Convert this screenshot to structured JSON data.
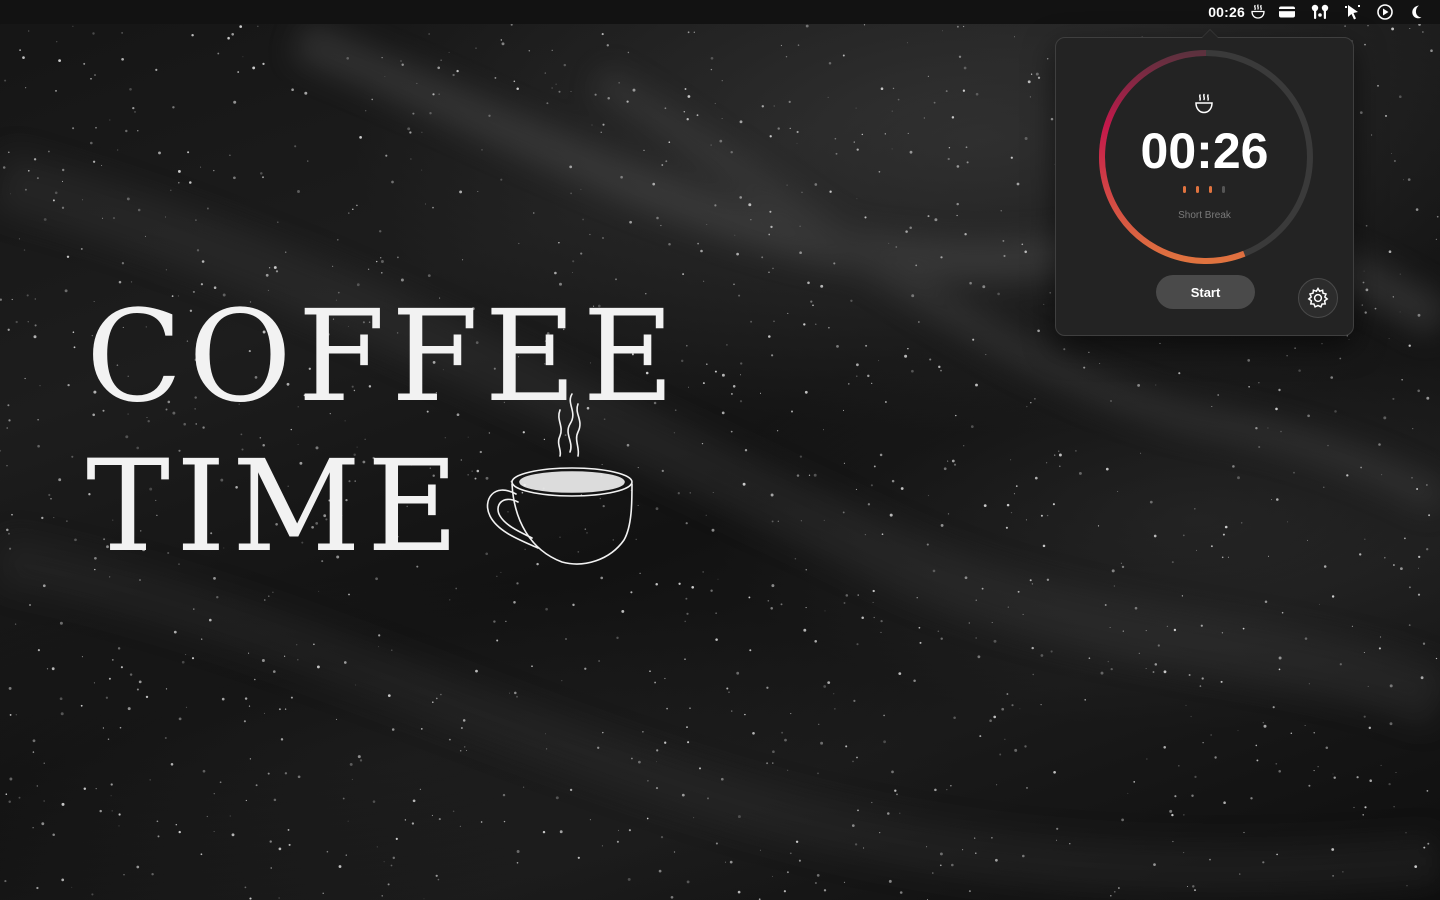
{
  "menubar": {
    "timer_text": "00:26",
    "icons": [
      "coffee-cup-icon",
      "card-icon",
      "airpods-icon",
      "cursor-icon",
      "play-circle-icon",
      "moon-icon"
    ]
  },
  "wallpaper": {
    "title_line1": "COFFEE",
    "title_line2": "TIME",
    "cup_drawing": "coffee-cup-illustration"
  },
  "timer_popover": {
    "time": "00:26",
    "mode": "Short Break",
    "start_label": "Start",
    "sessions_completed": 3,
    "sessions_total": 4,
    "progress_fraction": 0.56,
    "colors": {
      "progress_start": "#e0733f",
      "progress_end": "#c4184b",
      "track": "#3a3a3a",
      "dot_active": "#e0733f",
      "dot_inactive": "#555555"
    },
    "icons": [
      "coffee-cup-icon",
      "gear-icon"
    ]
  }
}
